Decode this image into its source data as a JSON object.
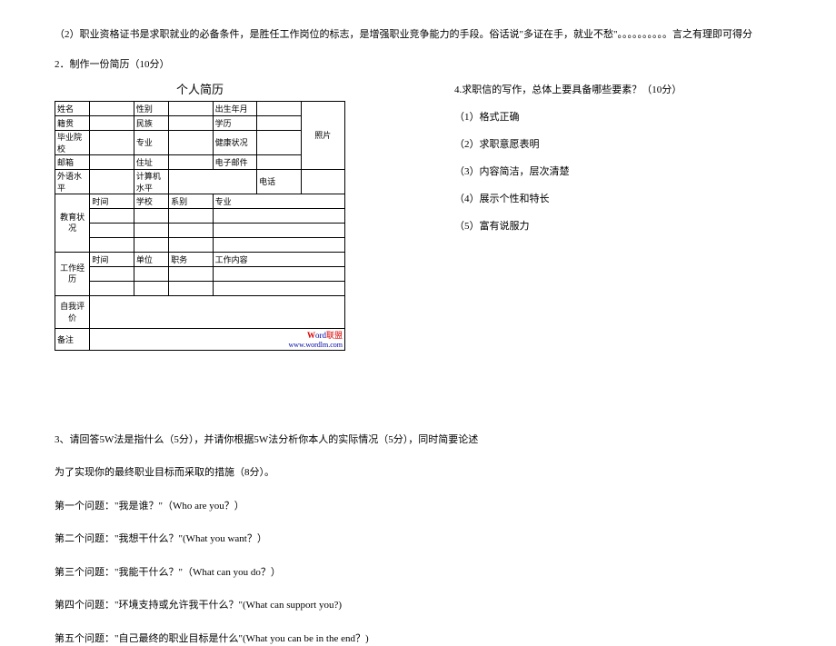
{
  "intro": {
    "line2": "（2）职业资格证书是求职就业的必备条件，是胜任工作岗位的标志，是增强职业竞争能力的手段。俗话说\"多证在手，就业不愁\"。。。。。。。。。。言之有理即可得分"
  },
  "q2": {
    "title": "2．制作一份简历（10分）",
    "resume_title": "个人简历",
    "labels": {
      "name": "姓名",
      "gender": "性别",
      "dob": "出生年月",
      "photo": "照片",
      "native": "籍贯",
      "ethnic": "民族",
      "education": "学历",
      "grad_school": "毕业院校",
      "major": "专业",
      "health": "健康状况",
      "email": "邮箱",
      "address": "住址",
      "email2": "电子邮件",
      "lang": "外语水平",
      "computer": "计算机水平",
      "phone": "电话",
      "edu_exp": "教育状况",
      "time": "时间",
      "school": "学校",
      "dept": "系别",
      "major2": "专业",
      "work_exp": "工作经历",
      "time2": "时间",
      "company": "单位",
      "position": "职务",
      "content": "工作内容",
      "self_eval": "自我评价",
      "remark": "备注"
    },
    "word_logo": {
      "w": "W",
      "ord": "ord",
      "lm": "联盟",
      "url": "www.wordlm.com"
    }
  },
  "q4": {
    "title": "4.求职信的写作，总体上要具备哪些要素？（10分）",
    "items": [
      "（1）格式正确",
      "（2）求职意愿表明",
      "（3）内容简洁，层次清楚",
      "（4）展示个性和特长",
      "（5）富有说服力"
    ]
  },
  "q3": {
    "line1": "3、请回答5W法是指什么（5分），并请你根据5W法分析你本人的实际情况（5分），同时简要论述",
    "line2": "为了实现你的最终职业目标而采取的措施（8分）。",
    "qs": [
      "第一个问题：\"我是谁？\"（Who are you？）",
      "第二个问题：\"我想干什么？\"(What you want？）",
      "第三个问题：\"我能干什么？\"（What can you do？）",
      "第四个问题：\"环境支持或允许我干什么？\"(What can support you?)",
      "第五个问题：\"自己最终的职业目标是什么\"(What you can be in the end？)"
    ]
  }
}
